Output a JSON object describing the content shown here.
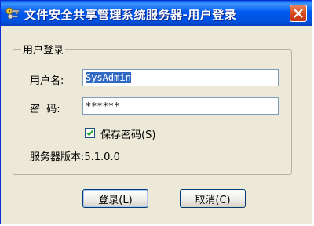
{
  "window": {
    "title": "文件安全共享管理系统服务器-用户登录",
    "close_label": "关闭"
  },
  "login_group": {
    "legend": "用户登录",
    "username_label": "用户名:",
    "username_value": "SysAdmin",
    "password_label": "密  码:",
    "password_value": "******",
    "remember_label": "保存密码(S)",
    "remember_checked": true,
    "version_text": "服务器版本:5.1.0.0"
  },
  "buttons": {
    "login_label": "登录(L)",
    "cancel_label": "取消(C)"
  },
  "colors": {
    "titlebar": "#0058ee",
    "window_bg": "#ece9d8",
    "selection": "#316ac5",
    "close_button": "#d4451a"
  },
  "icons": {
    "app": "keys-app-icon",
    "close": "close-x-icon",
    "check": "checkmark-icon"
  }
}
